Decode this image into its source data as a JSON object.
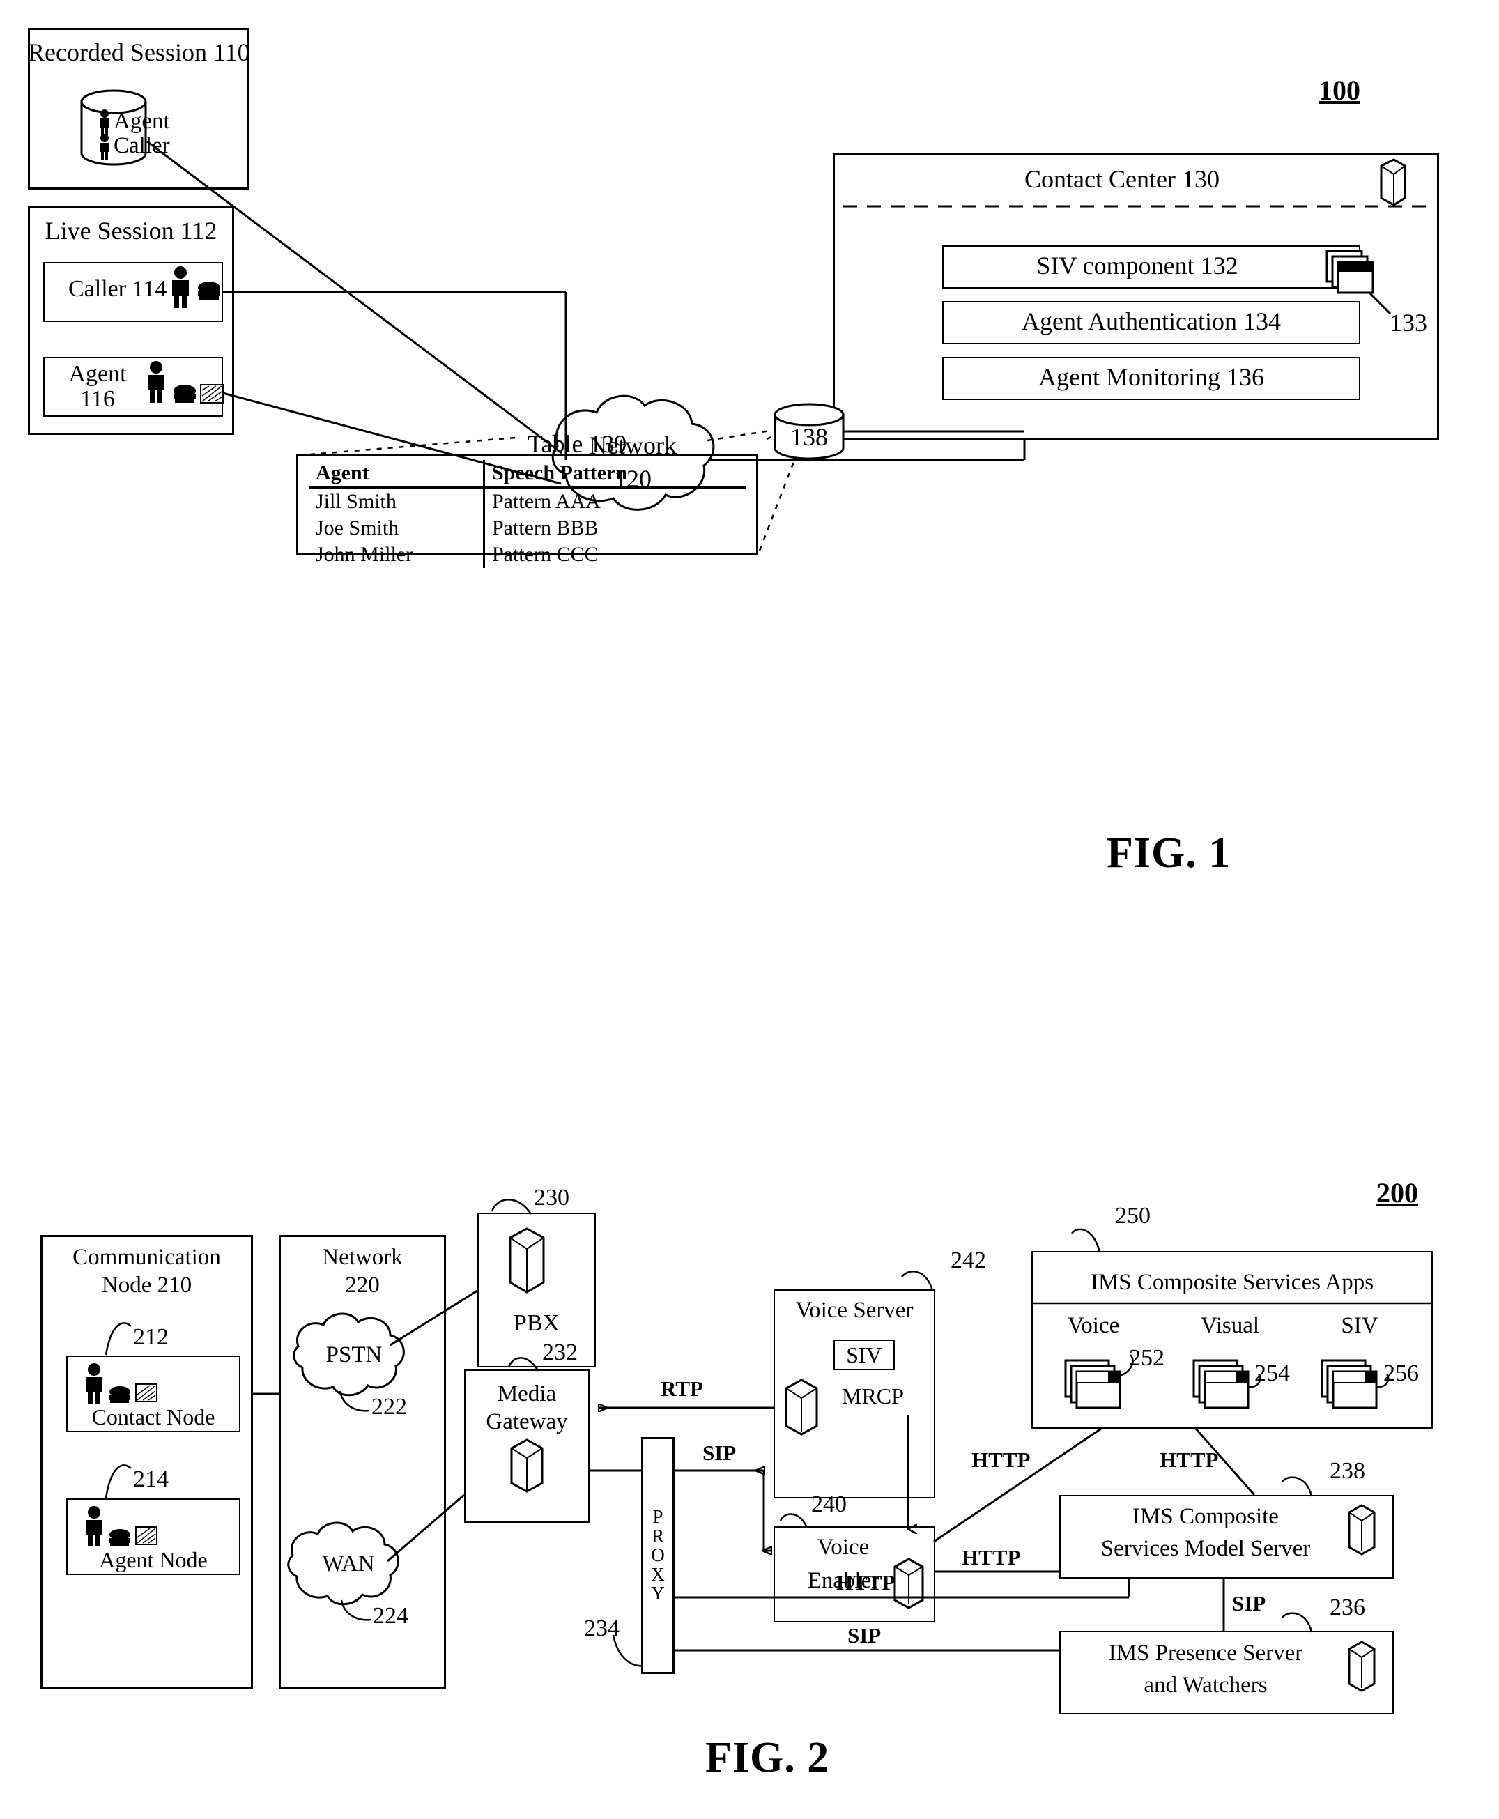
{
  "figure1": {
    "ref": "100",
    "caption": "FIG. 1",
    "recorded_session": {
      "title": "Recorded Session 110",
      "db_lines": [
        "Agent",
        "Caller"
      ]
    },
    "live_session": {
      "title": "Live Session 112",
      "caller": "Caller 114",
      "agent_line1": "Agent",
      "agent_line2": "116"
    },
    "network": {
      "line1": "Network",
      "line2": "120"
    },
    "contact_center": {
      "title": "Contact Center 130",
      "components": [
        "SIV component 132",
        "Agent Authentication 134",
        "Agent Monitoring 136"
      ],
      "siv_stack_ref": "133"
    },
    "database": {
      "label": "138"
    },
    "table": {
      "title": "Table 139",
      "headers": [
        "Agent",
        "Speech Pattern"
      ],
      "rows": [
        [
          "Jill Smith",
          "Pattern AAA"
        ],
        [
          "Joe Smith",
          "Pattern BBB"
        ],
        [
          "John Miller",
          "Pattern CCC"
        ]
      ]
    }
  },
  "figure2": {
    "ref": "200",
    "caption": "FIG. 2",
    "communication_node": {
      "title_line1": "Communication",
      "title_line2": "Node 210",
      "contact_node": {
        "ref": "212",
        "label": "Contact Node"
      },
      "agent_node": {
        "ref": "214",
        "label": "Agent Node"
      }
    },
    "network": {
      "title_line1": "Network",
      "title_line2": "220",
      "pstn": {
        "label": "PSTN",
        "ref": "222"
      },
      "wan": {
        "label": "WAN",
        "ref": "224"
      }
    },
    "pbx": {
      "label": "PBX",
      "ref": "230"
    },
    "media_gateway": {
      "line1": "Media",
      "line2": "Gateway",
      "ref": "232"
    },
    "proxy": {
      "letters": [
        "P",
        "R",
        "O",
        "X",
        "Y"
      ],
      "ref": "234"
    },
    "voice_server": {
      "title": "Voice Server",
      "siv": "SIV",
      "mrcp": "MRCP",
      "ref": "242"
    },
    "voice_enabler": {
      "line1": "Voice",
      "line2": "Enabler",
      "ref": "240"
    },
    "ims_apps": {
      "title": "IMS Composite Services Apps",
      "ref": "250",
      "items": [
        {
          "label": "Voice",
          "ref": "252"
        },
        {
          "label": "Visual",
          "ref": "254"
        },
        {
          "label": "SIV",
          "ref": "256"
        }
      ]
    },
    "ims_model_server": {
      "line1": "IMS Composite",
      "line2": "Services Model Server",
      "ref": "238"
    },
    "ims_presence_server": {
      "line1": "IMS Presence Server",
      "line2": "and Watchers",
      "ref": "236"
    },
    "protocols": {
      "rtp": "RTP",
      "mrcp": "MRCP",
      "sip_proxy_enabler": "SIP",
      "http_apps_left": "HTTP",
      "http_apps_right": "HTTP",
      "http_enabler_model": "HTTP",
      "http_proxy_model": "HTTP",
      "sip_proxy_presence": "SIP",
      "sip_model_presence": "SIP"
    }
  }
}
